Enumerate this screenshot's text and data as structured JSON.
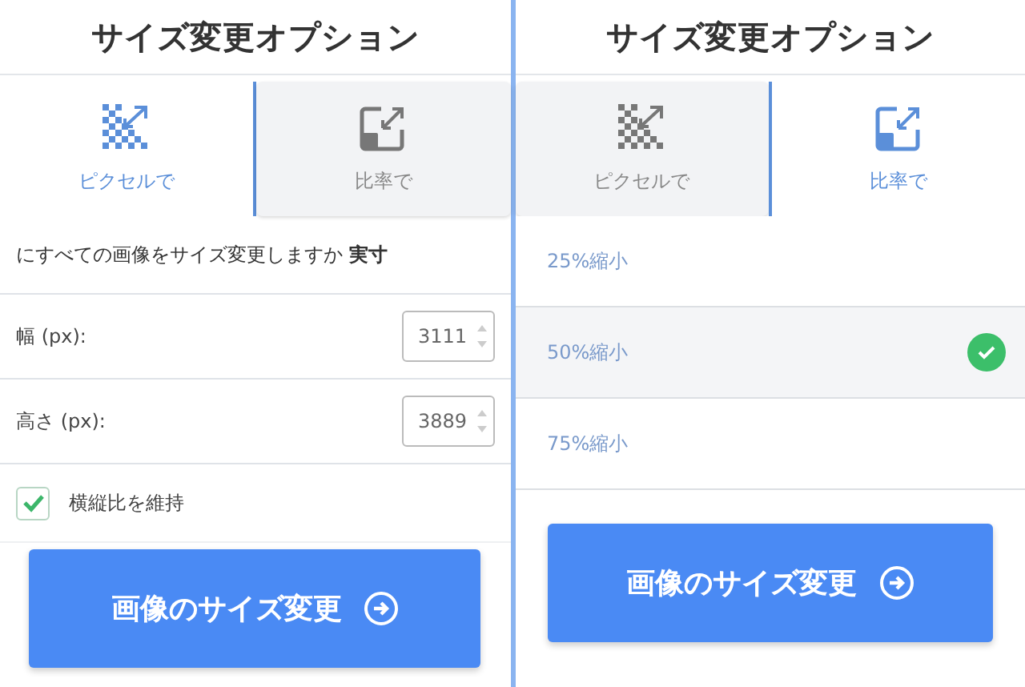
{
  "panels": [
    {
      "title": "サイズ変更オプション",
      "tabs": [
        {
          "label": "ピクセルで",
          "kind": "pixels",
          "selected": true
        },
        {
          "label": "比率で",
          "kind": "percent",
          "selected": false
        }
      ],
      "content": {
        "kind": "pixels",
        "description": "にすべての画像をサイズ変更しますか **実寸**",
        "fields": [
          {
            "label": "幅 (px):",
            "value": "3111"
          },
          {
            "label": "高さ (px):",
            "value": "3889"
          }
        ],
        "keep_ratio": {
          "label": "横縦比を維持",
          "checked": true
        }
      },
      "button": "画像のサイズ変更"
    },
    {
      "title": "サイズ変更オプション",
      "tabs": [
        {
          "label": "ピクセルで",
          "kind": "pixels",
          "selected": false
        },
        {
          "label": "比率で",
          "kind": "percent",
          "selected": true
        }
      ],
      "content": {
        "kind": "percent",
        "options": [
          {
            "label": "25%縮小",
            "selected": false
          },
          {
            "label": "50%縮小",
            "selected": true
          },
          {
            "label": "75%縮小",
            "selected": false
          }
        ]
      },
      "button": "画像のサイズ変更"
    }
  ]
}
